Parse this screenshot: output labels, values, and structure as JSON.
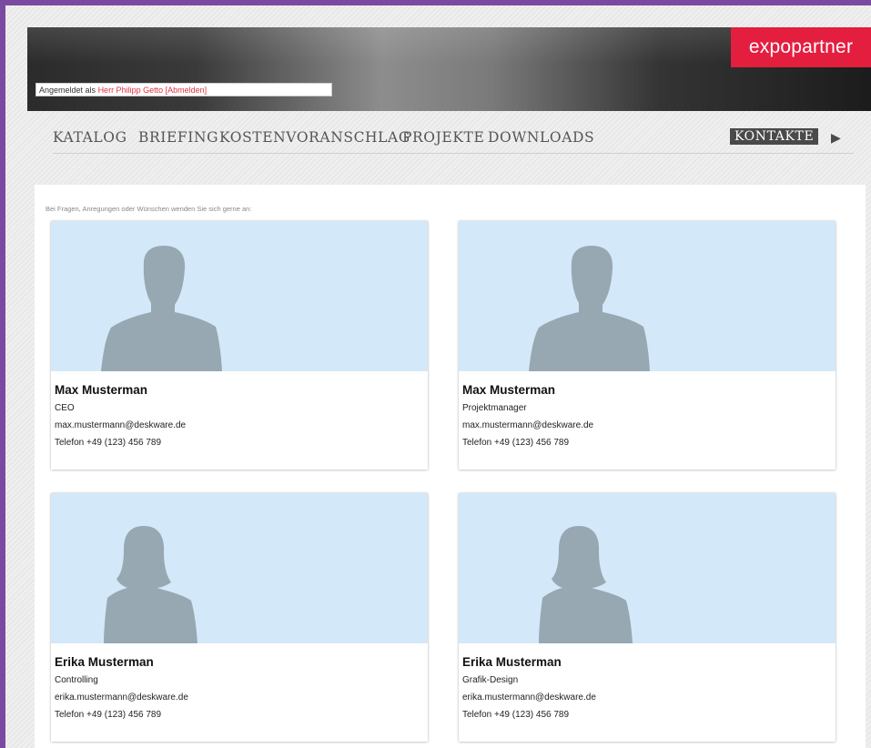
{
  "header": {
    "login_prefix": "Angemeldet als",
    "login_user": "Herr Philipp Getto",
    "logout_label": "[Abmelden]",
    "brand": "expopartner"
  },
  "nav": {
    "items": [
      "KATALOG",
      "BRIEFING",
      "KOSTENVORANSCHLAG",
      "PROJEKTE",
      "DOWNLOADS"
    ],
    "active": "KONTAKTE",
    "arrow": "▶"
  },
  "intro": "Bei Fragen, Anregungen oder Wünschen wenden Sie sich gerne an:",
  "contacts": [
    {
      "name": "Max Musterman",
      "role": "CEO",
      "email": "max.mustermann@deskware.de",
      "phone": "Telefon +49 (123) 456 789"
    },
    {
      "name": "Max Musterman",
      "role": "Projektmanager",
      "email": "max.mustermann@deskware.de",
      "phone": "Telefon +49 (123) 456 789"
    },
    {
      "name": "Erika Musterman",
      "role": "Controlling",
      "email": "erika.mustermann@deskware.de",
      "phone": "Telefon +49 (123) 456 789"
    },
    {
      "name": "Erika Musterman",
      "role": "Grafik-Design",
      "email": "erika.mustermann@deskware.de",
      "phone": "Telefon +49 (123) 456 789"
    }
  ],
  "colors": {
    "brand": "#e41e3f",
    "photo_bg": "#d3e8f8",
    "silhouette": "#97a8b2",
    "frame": "#7a4aa0"
  }
}
